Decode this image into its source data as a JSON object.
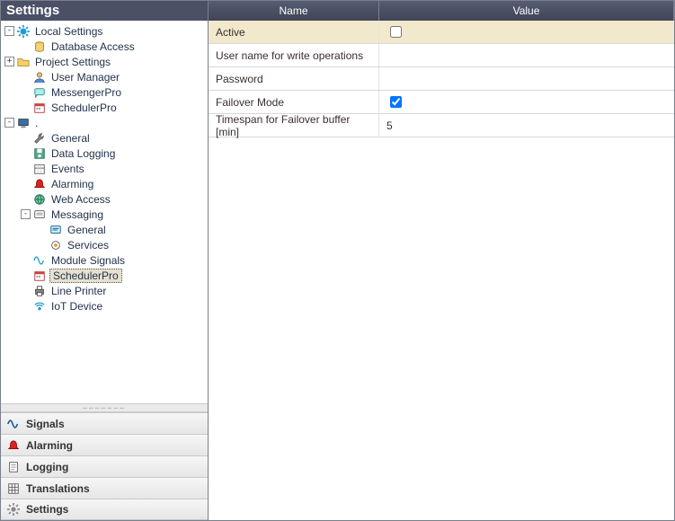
{
  "left_panel": {
    "title": "Settings",
    "tree": [
      {
        "id": "local-settings",
        "label": "Local Settings",
        "level": 0,
        "expander": "-",
        "icon": "gear-blue",
        "selected": false
      },
      {
        "id": "database-access",
        "label": "Database Access",
        "level": 1,
        "expander": "",
        "icon": "database",
        "selected": false
      },
      {
        "id": "project-settings",
        "label": "Project Settings",
        "level": 0,
        "expander": "+",
        "icon": "folder",
        "selected": false
      },
      {
        "id": "user-manager",
        "label": "User Manager",
        "level": 1,
        "expander": "",
        "icon": "user",
        "selected": false
      },
      {
        "id": "messengerpro",
        "label": "MessengerPro",
        "level": 1,
        "expander": "",
        "icon": "chat",
        "selected": false
      },
      {
        "id": "schedulerpro-top",
        "label": "SchedulerPro",
        "level": 1,
        "expander": "",
        "icon": "calendar",
        "selected": false
      },
      {
        "id": "station",
        "label": ".",
        "level": 0,
        "expander": "-",
        "icon": "monitor",
        "selected": false
      },
      {
        "id": "general",
        "label": "General",
        "level": 1,
        "expander": "",
        "icon": "wrench",
        "selected": false
      },
      {
        "id": "data-logging",
        "label": "Data Logging",
        "level": 1,
        "expander": "",
        "icon": "disk",
        "selected": false
      },
      {
        "id": "events",
        "label": "Events",
        "level": 1,
        "expander": "",
        "icon": "calendar2",
        "selected": false
      },
      {
        "id": "alarming-tree",
        "label": "Alarming",
        "level": 1,
        "expander": "",
        "icon": "bell",
        "selected": false
      },
      {
        "id": "web-access",
        "label": "Web Access",
        "level": 1,
        "expander": "",
        "icon": "globe",
        "selected": false
      },
      {
        "id": "messaging",
        "label": "Messaging",
        "level": 1,
        "expander": "-",
        "icon": "message",
        "selected": false
      },
      {
        "id": "msg-general",
        "label": "General",
        "level": 2,
        "expander": "",
        "icon": "message2",
        "selected": false
      },
      {
        "id": "msg-services",
        "label": "Services",
        "level": 2,
        "expander": "",
        "icon": "service",
        "selected": false
      },
      {
        "id": "module-signals",
        "label": "Module Signals",
        "level": 1,
        "expander": "",
        "icon": "wave",
        "selected": false
      },
      {
        "id": "schedulerpro",
        "label": "SchedulerPro",
        "level": 1,
        "expander": "",
        "icon": "calendar",
        "selected": true
      },
      {
        "id": "line-printer",
        "label": "Line Printer",
        "level": 1,
        "expander": "",
        "icon": "printer",
        "selected": false
      },
      {
        "id": "iot-device",
        "label": "IoT Device",
        "level": 1,
        "expander": "",
        "icon": "iot",
        "selected": false
      }
    ],
    "bottom_nav": [
      {
        "id": "signals-tab",
        "label": "Signals",
        "icon": "wave-blue"
      },
      {
        "id": "alarming-tab",
        "label": "Alarming",
        "icon": "bell-red"
      },
      {
        "id": "logging-tab",
        "label": "Logging",
        "icon": "log"
      },
      {
        "id": "translations-tab",
        "label": "Translations",
        "icon": "grid"
      },
      {
        "id": "settings-tab",
        "label": "Settings",
        "icon": "gear-gray"
      }
    ]
  },
  "property_grid": {
    "columns": {
      "name_header": "Name",
      "value_header": "Value"
    },
    "rows": [
      {
        "key": "active",
        "name": "Active",
        "type": "checkbox",
        "checked": false,
        "highlight": true
      },
      {
        "key": "username",
        "name": "User name for write operations",
        "type": "text",
        "value": ""
      },
      {
        "key": "password",
        "name": "Password",
        "type": "text",
        "value": ""
      },
      {
        "key": "failover",
        "name": "Failover Mode",
        "type": "checkbox",
        "checked": true,
        "highlight": false
      },
      {
        "key": "timespan",
        "name": "Timespan for Failover buffer [min]",
        "type": "text",
        "value": "5"
      }
    ]
  }
}
